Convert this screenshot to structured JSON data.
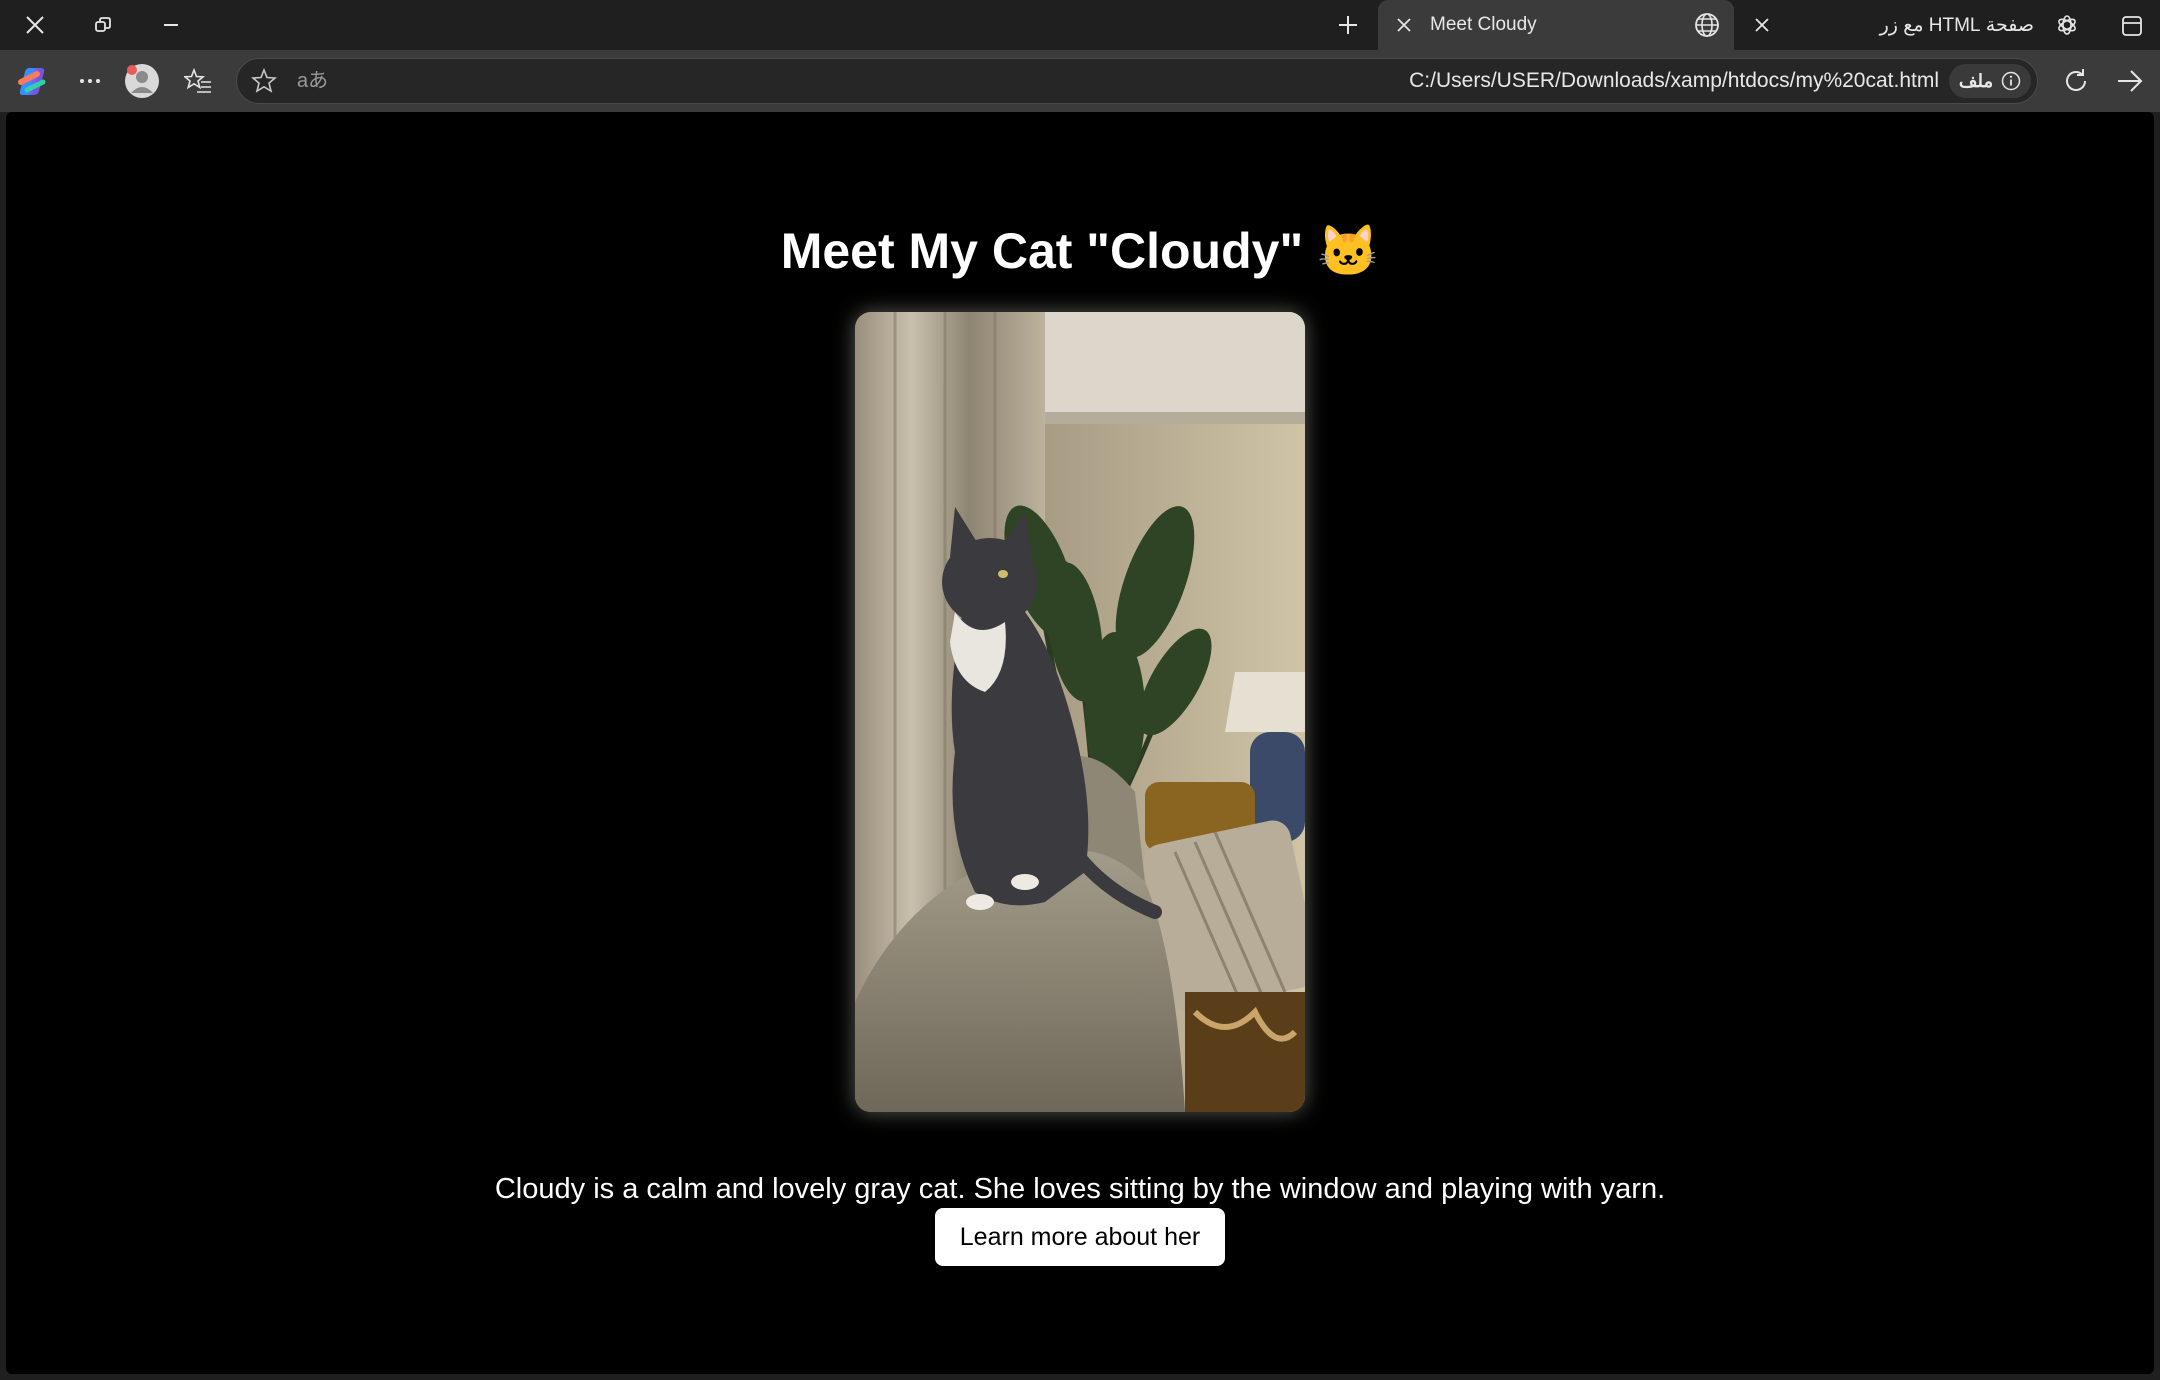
{
  "browser": {
    "tabs": [
      {
        "title": "Meet Cloudy",
        "active": true,
        "favicon": "globe-icon"
      },
      {
        "title": "صفحة HTML مع زر",
        "active": false,
        "favicon": "chatgpt-icon"
      }
    ],
    "address": {
      "url": "C:/Users/USER/Downloads/xamp/htdocs/my%20cat.html",
      "chip_label": "ملف",
      "read_aloud_glyph": "aあ"
    },
    "colors": {
      "frame": "#1f1f1f",
      "toolbar": "#3b3b3b",
      "address_bg": "#262626"
    }
  },
  "page": {
    "title": "Meet My Cat \"Cloudy\" 🐱",
    "description": "Cloudy is a calm and lovely gray cat. She loves sitting by the window and playing with yarn.",
    "button_label": "Learn more about her",
    "colors": {
      "background": "#000000",
      "text": "#ffffff",
      "button_bg": "#ffffff",
      "button_text": "#000000"
    }
  }
}
